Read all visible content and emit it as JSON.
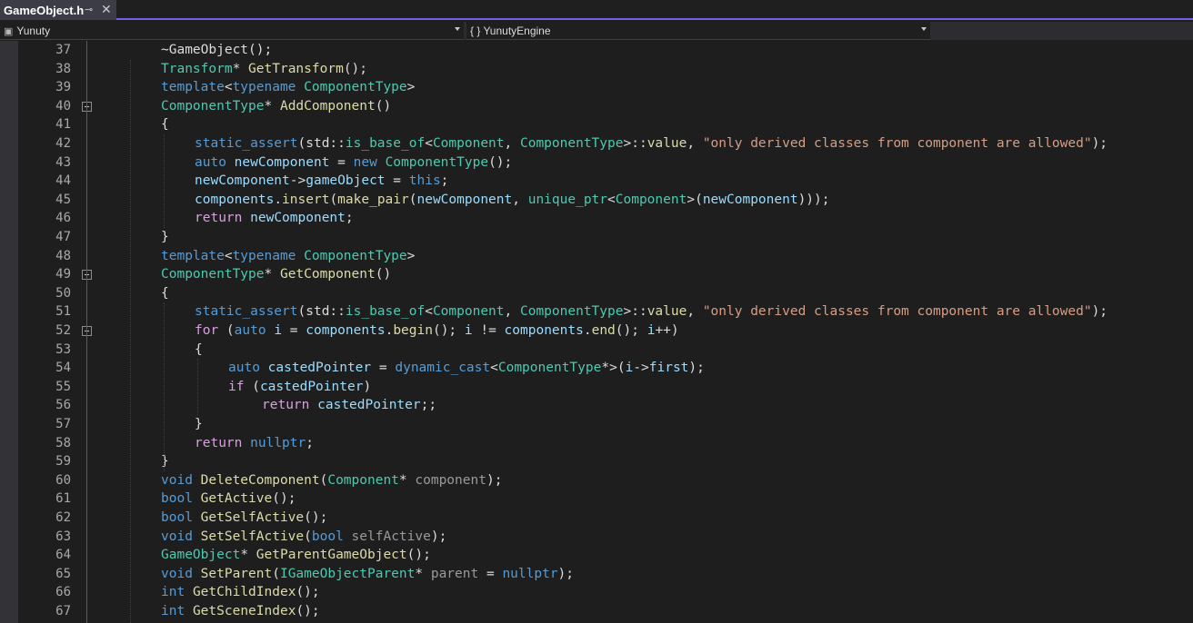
{
  "tab": {
    "title": "GameObject.h",
    "pin_icon": "pin-icon",
    "close_icon": "close-icon"
  },
  "navbar": {
    "project": "Yunuty",
    "scope": "{ } YunutyEngine"
  },
  "editor": {
    "lines": [
      {
        "n": "37",
        "fold": false,
        "indent": 1,
        "tokens": [
          [
            "tx",
            "~GameObject"
          ],
          [
            "tx",
            "();"
          ]
        ]
      },
      {
        "n": "38",
        "fold": false,
        "indent": 1,
        "tokens": [
          [
            "ty",
            "Transform"
          ],
          [
            "tx",
            "* "
          ],
          [
            "fn",
            "GetTransform"
          ],
          [
            "tx",
            "();"
          ]
        ]
      },
      {
        "n": "39",
        "fold": false,
        "indent": 1,
        "tokens": [
          [
            "kw",
            "template"
          ],
          [
            "tx",
            "<"
          ],
          [
            "kw",
            "typename"
          ],
          [
            "tx",
            " "
          ],
          [
            "ty",
            "ComponentType"
          ],
          [
            "tx",
            ">"
          ]
        ]
      },
      {
        "n": "40",
        "fold": true,
        "indent": 1,
        "tokens": [
          [
            "ty",
            "ComponentType"
          ],
          [
            "tx",
            "* "
          ],
          [
            "fn",
            "AddComponent"
          ],
          [
            "tx",
            "()"
          ]
        ]
      },
      {
        "n": "41",
        "fold": false,
        "indent": 1,
        "tokens": [
          [
            "tx",
            "{"
          ]
        ]
      },
      {
        "n": "42",
        "fold": false,
        "indent": 2,
        "tokens": [
          [
            "kw",
            "static_assert"
          ],
          [
            "tx",
            "("
          ],
          [
            "tx",
            "std::"
          ],
          [
            "ty",
            "is_base_of"
          ],
          [
            "tx",
            "<"
          ],
          [
            "ty",
            "Component"
          ],
          [
            "tx",
            ", "
          ],
          [
            "ty",
            "ComponentType"
          ],
          [
            "tx",
            ">::"
          ],
          [
            "fn",
            "value"
          ],
          [
            "tx",
            ", "
          ],
          [
            "st",
            "\"only derived classes from component are allowed\""
          ],
          [
            "tx",
            ");"
          ]
        ]
      },
      {
        "n": "43",
        "fold": false,
        "indent": 2,
        "tokens": [
          [
            "kw",
            "auto"
          ],
          [
            "tx",
            " "
          ],
          [
            "va",
            "newComponent"
          ],
          [
            "tx",
            " = "
          ],
          [
            "kw",
            "new"
          ],
          [
            "tx",
            " "
          ],
          [
            "ty",
            "ComponentType"
          ],
          [
            "tx",
            "();"
          ]
        ]
      },
      {
        "n": "44",
        "fold": false,
        "indent": 2,
        "tokens": [
          [
            "va",
            "newComponent"
          ],
          [
            "tx",
            "->"
          ],
          [
            "va",
            "gameObject"
          ],
          [
            "tx",
            " = "
          ],
          [
            "kw",
            "this"
          ],
          [
            "tx",
            ";"
          ]
        ]
      },
      {
        "n": "45",
        "fold": false,
        "indent": 2,
        "tokens": [
          [
            "va",
            "components"
          ],
          [
            "tx",
            "."
          ],
          [
            "fn",
            "insert"
          ],
          [
            "tx",
            "("
          ],
          [
            "fn",
            "make_pair"
          ],
          [
            "tx",
            "("
          ],
          [
            "va",
            "newComponent"
          ],
          [
            "tx",
            ", "
          ],
          [
            "ty",
            "unique_ptr"
          ],
          [
            "tx",
            "<"
          ],
          [
            "ty",
            "Component"
          ],
          [
            "tx",
            ">("
          ],
          [
            "va",
            "newComponent"
          ],
          [
            "tx",
            ")));"
          ]
        ]
      },
      {
        "n": "46",
        "fold": false,
        "indent": 2,
        "tokens": [
          [
            "ctl",
            "return"
          ],
          [
            "tx",
            " "
          ],
          [
            "va",
            "newComponent"
          ],
          [
            "tx",
            ";"
          ]
        ]
      },
      {
        "n": "47",
        "fold": false,
        "indent": 1,
        "tokens": [
          [
            "tx",
            "}"
          ]
        ]
      },
      {
        "n": "48",
        "fold": false,
        "indent": 1,
        "tokens": [
          [
            "kw",
            "template"
          ],
          [
            "tx",
            "<"
          ],
          [
            "kw",
            "typename"
          ],
          [
            "tx",
            " "
          ],
          [
            "ty",
            "ComponentType"
          ],
          [
            "tx",
            ">"
          ]
        ]
      },
      {
        "n": "49",
        "fold": true,
        "indent": 1,
        "tokens": [
          [
            "ty",
            "ComponentType"
          ],
          [
            "tx",
            "* "
          ],
          [
            "fn",
            "GetComponent"
          ],
          [
            "tx",
            "()"
          ]
        ]
      },
      {
        "n": "50",
        "fold": false,
        "indent": 1,
        "tokens": [
          [
            "tx",
            "{"
          ]
        ]
      },
      {
        "n": "51",
        "fold": false,
        "indent": 2,
        "tokens": [
          [
            "kw",
            "static_assert"
          ],
          [
            "tx",
            "("
          ],
          [
            "tx",
            "std::"
          ],
          [
            "ty",
            "is_base_of"
          ],
          [
            "tx",
            "<"
          ],
          [
            "ty",
            "Component"
          ],
          [
            "tx",
            ", "
          ],
          [
            "ty",
            "ComponentType"
          ],
          [
            "tx",
            ">::"
          ],
          [
            "fn",
            "value"
          ],
          [
            "tx",
            ", "
          ],
          [
            "st",
            "\"only derived classes from component are allowed\""
          ],
          [
            "tx",
            ");"
          ]
        ]
      },
      {
        "n": "52",
        "fold": true,
        "indent": 2,
        "tokens": [
          [
            "ctl",
            "for"
          ],
          [
            "tx",
            " ("
          ],
          [
            "kw",
            "auto"
          ],
          [
            "tx",
            " "
          ],
          [
            "va",
            "i"
          ],
          [
            "tx",
            " = "
          ],
          [
            "va",
            "components"
          ],
          [
            "tx",
            "."
          ],
          [
            "fn",
            "begin"
          ],
          [
            "tx",
            "(); "
          ],
          [
            "va",
            "i"
          ],
          [
            "tx",
            " != "
          ],
          [
            "va",
            "components"
          ],
          [
            "tx",
            "."
          ],
          [
            "fn",
            "end"
          ],
          [
            "tx",
            "(); "
          ],
          [
            "va",
            "i"
          ],
          [
            "tx",
            "++)"
          ]
        ]
      },
      {
        "n": "53",
        "fold": false,
        "indent": 2,
        "tokens": [
          [
            "tx",
            "{"
          ]
        ]
      },
      {
        "n": "54",
        "fold": false,
        "indent": 3,
        "tokens": [
          [
            "kw",
            "auto"
          ],
          [
            "tx",
            " "
          ],
          [
            "va",
            "castedPointer"
          ],
          [
            "tx",
            " = "
          ],
          [
            "kw",
            "dynamic_cast"
          ],
          [
            "tx",
            "<"
          ],
          [
            "ty",
            "ComponentType"
          ],
          [
            "tx",
            "*>("
          ],
          [
            "va",
            "i"
          ],
          [
            "tx",
            "->"
          ],
          [
            "va",
            "first"
          ],
          [
            "tx",
            ");"
          ]
        ]
      },
      {
        "n": "55",
        "fold": false,
        "indent": 3,
        "tokens": [
          [
            "ctl",
            "if"
          ],
          [
            "tx",
            " ("
          ],
          [
            "va",
            "castedPointer"
          ],
          [
            "tx",
            ")"
          ]
        ]
      },
      {
        "n": "56",
        "fold": false,
        "indent": 4,
        "tokens": [
          [
            "ctl",
            "return"
          ],
          [
            "tx",
            " "
          ],
          [
            "va",
            "castedPointer"
          ],
          [
            "tx",
            ";;"
          ]
        ]
      },
      {
        "n": "57",
        "fold": false,
        "indent": 2,
        "tokens": [
          [
            "tx",
            "}"
          ]
        ]
      },
      {
        "n": "58",
        "fold": false,
        "indent": 2,
        "tokens": [
          [
            "ctl",
            "return"
          ],
          [
            "tx",
            " "
          ],
          [
            "kw",
            "nullptr"
          ],
          [
            "tx",
            ";"
          ]
        ]
      },
      {
        "n": "59",
        "fold": false,
        "indent": 1,
        "tokens": [
          [
            "tx",
            "}"
          ]
        ]
      },
      {
        "n": "60",
        "fold": false,
        "indent": 1,
        "tokens": [
          [
            "kw",
            "void"
          ],
          [
            "tx",
            " "
          ],
          [
            "fn",
            "DeleteComponent"
          ],
          [
            "tx",
            "("
          ],
          [
            "ty",
            "Component"
          ],
          [
            "tx",
            "* "
          ],
          [
            "pa",
            "component"
          ],
          [
            "tx",
            ");"
          ]
        ]
      },
      {
        "n": "61",
        "fold": false,
        "indent": 1,
        "tokens": [
          [
            "kw",
            "bool"
          ],
          [
            "tx",
            " "
          ],
          [
            "fn",
            "GetActive"
          ],
          [
            "tx",
            "();"
          ]
        ]
      },
      {
        "n": "62",
        "fold": false,
        "indent": 1,
        "tokens": [
          [
            "kw",
            "bool"
          ],
          [
            "tx",
            " "
          ],
          [
            "fn",
            "GetSelfActive"
          ],
          [
            "tx",
            "();"
          ]
        ]
      },
      {
        "n": "63",
        "fold": false,
        "indent": 1,
        "tokens": [
          [
            "kw",
            "void"
          ],
          [
            "tx",
            " "
          ],
          [
            "fn",
            "SetSelfActive"
          ],
          [
            "tx",
            "("
          ],
          [
            "kw",
            "bool"
          ],
          [
            "tx",
            " "
          ],
          [
            "pa",
            "selfActive"
          ],
          [
            "tx",
            ");"
          ]
        ]
      },
      {
        "n": "64",
        "fold": false,
        "indent": 1,
        "tokens": [
          [
            "ty",
            "GameObject"
          ],
          [
            "tx",
            "* "
          ],
          [
            "fn",
            "GetParentGameObject"
          ],
          [
            "tx",
            "();"
          ]
        ]
      },
      {
        "n": "65",
        "fold": false,
        "indent": 1,
        "tokens": [
          [
            "kw",
            "void"
          ],
          [
            "tx",
            " "
          ],
          [
            "fn",
            "SetParent"
          ],
          [
            "tx",
            "("
          ],
          [
            "ty",
            "IGameObjectParent"
          ],
          [
            "tx",
            "* "
          ],
          [
            "pa",
            "parent"
          ],
          [
            "tx",
            " = "
          ],
          [
            "kw",
            "nullptr"
          ],
          [
            "tx",
            ");"
          ]
        ]
      },
      {
        "n": "66",
        "fold": false,
        "indent": 1,
        "tokens": [
          [
            "kw",
            "int"
          ],
          [
            "tx",
            " "
          ],
          [
            "fn",
            "GetChildIndex"
          ],
          [
            "tx",
            "();"
          ]
        ]
      },
      {
        "n": "67",
        "fold": false,
        "indent": 1,
        "tokens": [
          [
            "kw",
            "int"
          ],
          [
            "tx",
            " "
          ],
          [
            "fn",
            "GetSceneIndex"
          ],
          [
            "tx",
            "();"
          ]
        ]
      }
    ]
  }
}
